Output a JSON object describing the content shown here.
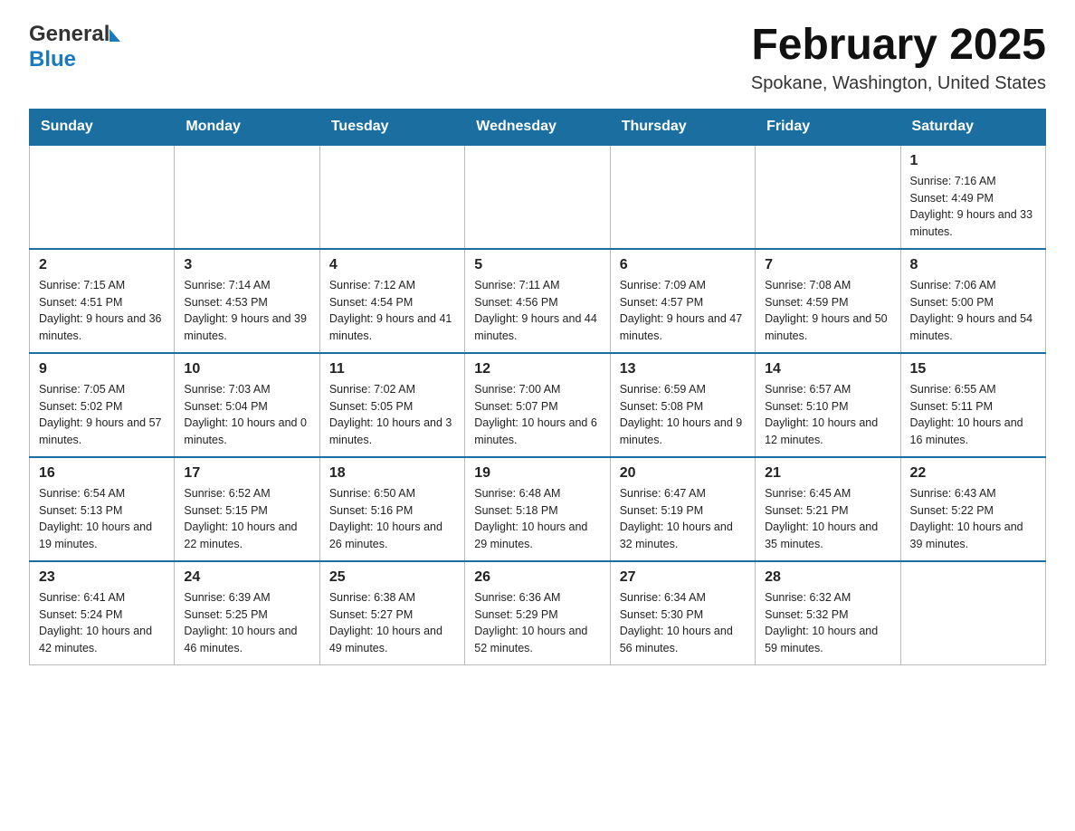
{
  "header": {
    "logo_general": "General",
    "logo_blue": "Blue",
    "month_title": "February 2025",
    "location": "Spokane, Washington, United States"
  },
  "days_of_week": [
    "Sunday",
    "Monday",
    "Tuesday",
    "Wednesday",
    "Thursday",
    "Friday",
    "Saturday"
  ],
  "weeks": [
    [
      {
        "day": "",
        "info": ""
      },
      {
        "day": "",
        "info": ""
      },
      {
        "day": "",
        "info": ""
      },
      {
        "day": "",
        "info": ""
      },
      {
        "day": "",
        "info": ""
      },
      {
        "day": "",
        "info": ""
      },
      {
        "day": "1",
        "info": "Sunrise: 7:16 AM\nSunset: 4:49 PM\nDaylight: 9 hours and 33 minutes."
      }
    ],
    [
      {
        "day": "2",
        "info": "Sunrise: 7:15 AM\nSunset: 4:51 PM\nDaylight: 9 hours and 36 minutes."
      },
      {
        "day": "3",
        "info": "Sunrise: 7:14 AM\nSunset: 4:53 PM\nDaylight: 9 hours and 39 minutes."
      },
      {
        "day": "4",
        "info": "Sunrise: 7:12 AM\nSunset: 4:54 PM\nDaylight: 9 hours and 41 minutes."
      },
      {
        "day": "5",
        "info": "Sunrise: 7:11 AM\nSunset: 4:56 PM\nDaylight: 9 hours and 44 minutes."
      },
      {
        "day": "6",
        "info": "Sunrise: 7:09 AM\nSunset: 4:57 PM\nDaylight: 9 hours and 47 minutes."
      },
      {
        "day": "7",
        "info": "Sunrise: 7:08 AM\nSunset: 4:59 PM\nDaylight: 9 hours and 50 minutes."
      },
      {
        "day": "8",
        "info": "Sunrise: 7:06 AM\nSunset: 5:00 PM\nDaylight: 9 hours and 54 minutes."
      }
    ],
    [
      {
        "day": "9",
        "info": "Sunrise: 7:05 AM\nSunset: 5:02 PM\nDaylight: 9 hours and 57 minutes."
      },
      {
        "day": "10",
        "info": "Sunrise: 7:03 AM\nSunset: 5:04 PM\nDaylight: 10 hours and 0 minutes."
      },
      {
        "day": "11",
        "info": "Sunrise: 7:02 AM\nSunset: 5:05 PM\nDaylight: 10 hours and 3 minutes."
      },
      {
        "day": "12",
        "info": "Sunrise: 7:00 AM\nSunset: 5:07 PM\nDaylight: 10 hours and 6 minutes."
      },
      {
        "day": "13",
        "info": "Sunrise: 6:59 AM\nSunset: 5:08 PM\nDaylight: 10 hours and 9 minutes."
      },
      {
        "day": "14",
        "info": "Sunrise: 6:57 AM\nSunset: 5:10 PM\nDaylight: 10 hours and 12 minutes."
      },
      {
        "day": "15",
        "info": "Sunrise: 6:55 AM\nSunset: 5:11 PM\nDaylight: 10 hours and 16 minutes."
      }
    ],
    [
      {
        "day": "16",
        "info": "Sunrise: 6:54 AM\nSunset: 5:13 PM\nDaylight: 10 hours and 19 minutes."
      },
      {
        "day": "17",
        "info": "Sunrise: 6:52 AM\nSunset: 5:15 PM\nDaylight: 10 hours and 22 minutes."
      },
      {
        "day": "18",
        "info": "Sunrise: 6:50 AM\nSunset: 5:16 PM\nDaylight: 10 hours and 26 minutes."
      },
      {
        "day": "19",
        "info": "Sunrise: 6:48 AM\nSunset: 5:18 PM\nDaylight: 10 hours and 29 minutes."
      },
      {
        "day": "20",
        "info": "Sunrise: 6:47 AM\nSunset: 5:19 PM\nDaylight: 10 hours and 32 minutes."
      },
      {
        "day": "21",
        "info": "Sunrise: 6:45 AM\nSunset: 5:21 PM\nDaylight: 10 hours and 35 minutes."
      },
      {
        "day": "22",
        "info": "Sunrise: 6:43 AM\nSunset: 5:22 PM\nDaylight: 10 hours and 39 minutes."
      }
    ],
    [
      {
        "day": "23",
        "info": "Sunrise: 6:41 AM\nSunset: 5:24 PM\nDaylight: 10 hours and 42 minutes."
      },
      {
        "day": "24",
        "info": "Sunrise: 6:39 AM\nSunset: 5:25 PM\nDaylight: 10 hours and 46 minutes."
      },
      {
        "day": "25",
        "info": "Sunrise: 6:38 AM\nSunset: 5:27 PM\nDaylight: 10 hours and 49 minutes."
      },
      {
        "day": "26",
        "info": "Sunrise: 6:36 AM\nSunset: 5:29 PM\nDaylight: 10 hours and 52 minutes."
      },
      {
        "day": "27",
        "info": "Sunrise: 6:34 AM\nSunset: 5:30 PM\nDaylight: 10 hours and 56 minutes."
      },
      {
        "day": "28",
        "info": "Sunrise: 6:32 AM\nSunset: 5:32 PM\nDaylight: 10 hours and 59 minutes."
      },
      {
        "day": "",
        "info": ""
      }
    ]
  ]
}
